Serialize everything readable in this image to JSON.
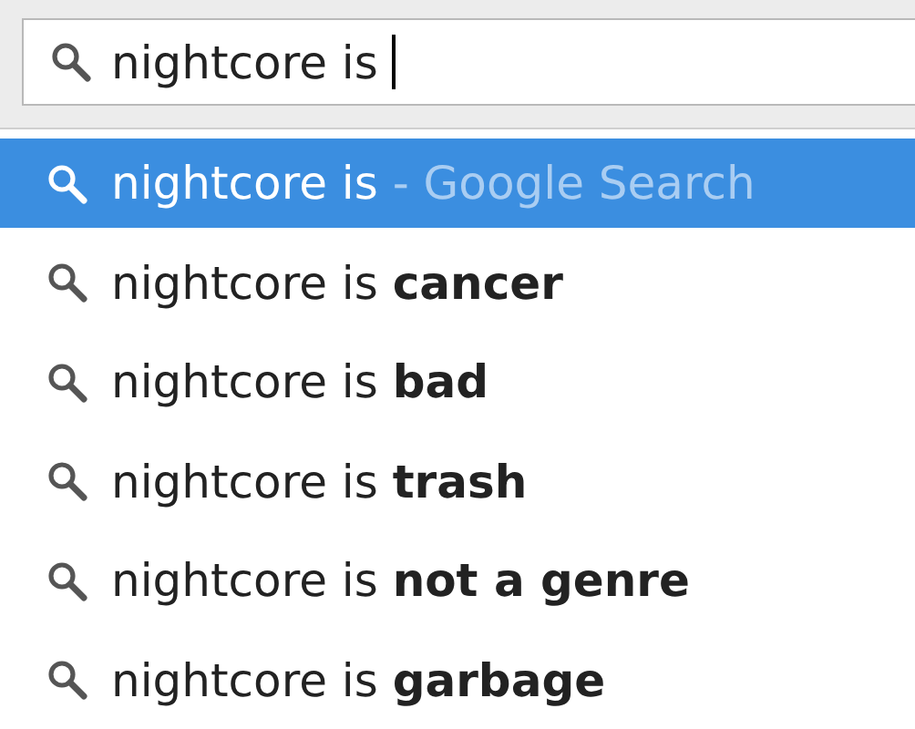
{
  "search": {
    "value": "nightcore is "
  },
  "suggestions": [
    {
      "text": "nightcore is",
      "hint": "- Google Search",
      "selected": true
    },
    {
      "text": "nightcore is **cancer**",
      "selected": false
    },
    {
      "text": "nightcore is **bad**",
      "selected": false
    },
    {
      "text": "nightcore is **trash**",
      "selected": false
    },
    {
      "text": "nightcore is **not a genre**",
      "selected": false
    },
    {
      "text": "nightcore is **garbage**",
      "selected": false
    }
  ]
}
